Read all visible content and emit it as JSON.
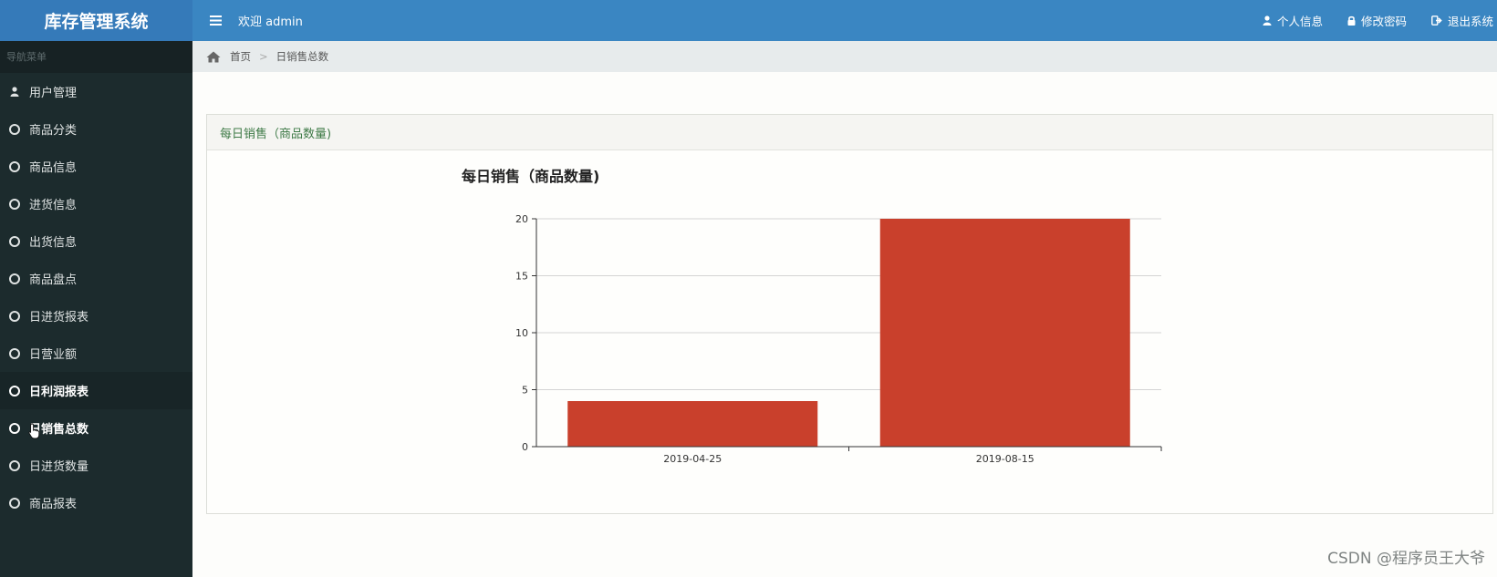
{
  "app": {
    "title": "库存管理系统"
  },
  "sidebar": {
    "nav_header": "导航菜单",
    "items": [
      {
        "label": "用户管理",
        "icon": "user-icon"
      },
      {
        "label": "商品分类",
        "icon": "circle-icon"
      },
      {
        "label": "商品信息",
        "icon": "circle-icon"
      },
      {
        "label": "进货信息",
        "icon": "circle-icon"
      },
      {
        "label": "出货信息",
        "icon": "circle-icon"
      },
      {
        "label": "商品盘点",
        "icon": "circle-icon"
      },
      {
        "label": "日进货报表",
        "icon": "circle-icon"
      },
      {
        "label": "日营业额",
        "icon": "circle-icon"
      },
      {
        "label": "日利润报表",
        "icon": "circle-icon"
      },
      {
        "label": "日销售总数",
        "icon": "circle-icon"
      },
      {
        "label": "日进货数量",
        "icon": "circle-icon"
      },
      {
        "label": "商品报表",
        "icon": "circle-icon"
      }
    ]
  },
  "topbar": {
    "welcome": "欢迎 admin",
    "profile_label": "个人信息",
    "change_password_label": "修改密码",
    "logout_label": "退出系统"
  },
  "breadcrumb": {
    "home": "首页",
    "current": "日销售总数"
  },
  "panel": {
    "title": "每日销售（商品数量)"
  },
  "chart_data": {
    "type": "bar",
    "title": "每日销售（商品数量)",
    "categories": [
      "2019-04-25",
      "2019-08-15"
    ],
    "values": [
      4,
      20
    ],
    "ylim": [
      0,
      20
    ],
    "yticks": [
      0,
      5,
      10,
      15,
      20
    ],
    "xlabel": "",
    "ylabel": "",
    "grid": true,
    "color": "#c9402c"
  },
  "watermark": "CSDN @程序员王大爷",
  "colors": {
    "brand": "#357ab9",
    "topbar": "#3a86c2",
    "sidebar": "#1c2b2d",
    "panel_title": "#3e7a47",
    "bar": "#c9402c"
  }
}
